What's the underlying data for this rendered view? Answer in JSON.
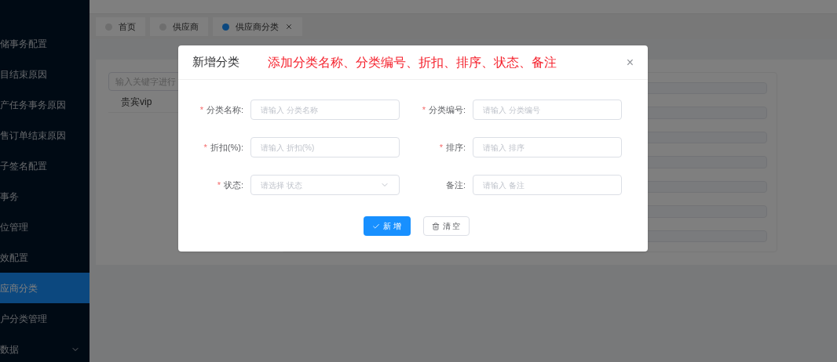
{
  "sidebar": {
    "items": [
      {
        "label": "储事务配置",
        "selected": false
      },
      {
        "label": "目结束原因",
        "selected": false
      },
      {
        "label": "产任务事务原因",
        "selected": false
      },
      {
        "label": "售订单结束原因",
        "selected": false
      },
      {
        "label": "子签名配置",
        "selected": false
      },
      {
        "label": "事务",
        "selected": false
      },
      {
        "label": "位管理",
        "selected": false
      },
      {
        "label": "效配置",
        "selected": false
      },
      {
        "label": "应商分类",
        "selected": true
      },
      {
        "label": "户分类管理",
        "selected": false
      },
      {
        "label": "数据",
        "selected": false,
        "expandable": true
      }
    ]
  },
  "tabs": [
    {
      "label": "首页",
      "selected": false,
      "closable": false
    },
    {
      "label": "供应商",
      "selected": false,
      "closable": false
    },
    {
      "label": "供应商分类",
      "selected": true,
      "closable": true
    }
  ],
  "category_list": {
    "search": {
      "placeholder": "输入关键字进行"
    },
    "items": [
      "贵宾vip"
    ]
  },
  "dialog": {
    "title": "新增分类",
    "note": "添加分类名称、分类编号、折扣、排序、状态、备注",
    "close": "×",
    "fields": [
      {
        "label": "分类名称:",
        "required_mark": "*",
        "kind": "input",
        "placeholder": "请输入 分类名称"
      },
      {
        "label": "分类编号:",
        "required_mark": "*",
        "kind": "input",
        "placeholder": "请输入 分类编号"
      },
      {
        "label": "折扣(%):",
        "required_mark": "*",
        "kind": "input",
        "placeholder": "请输入 折扣(%)"
      },
      {
        "label": "排序:",
        "required_mark": "*",
        "kind": "input",
        "placeholder": "请输入 排序"
      },
      {
        "label": "状态:",
        "required_mark": "*",
        "kind": "select",
        "placeholder": "请选择 状态"
      },
      {
        "label": "备注:",
        "kind": "input",
        "placeholder": "请输入 备注"
      }
    ],
    "buttons": [
      {
        "label": "新 增",
        "kind": "primary"
      },
      {
        "label": "清 空",
        "kind": "default"
      }
    ]
  }
}
